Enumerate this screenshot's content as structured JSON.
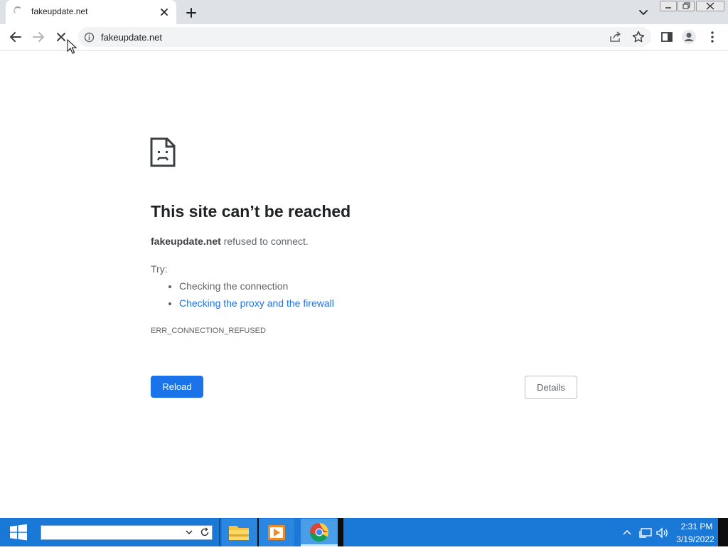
{
  "browser": {
    "tab_title": "fakeupdate.net",
    "address": "fakeupdate.net"
  },
  "error_page": {
    "title": "This site can’t be reached",
    "message_host": "fakeupdate.net",
    "message_rest": " refused to connect.",
    "try_label": "Try:",
    "suggestions": [
      "Checking the connection",
      "Checking the proxy and the firewall"
    ],
    "error_code": "ERR_CONNECTION_REFUSED",
    "reload_label": "Reload",
    "details_label": "Details"
  },
  "taskbar": {
    "search_value": "",
    "time": "2:31 PM",
    "date": "3/19/2022"
  },
  "colors": {
    "accent": "#1a73e8",
    "taskbar": "#1a78d6"
  }
}
